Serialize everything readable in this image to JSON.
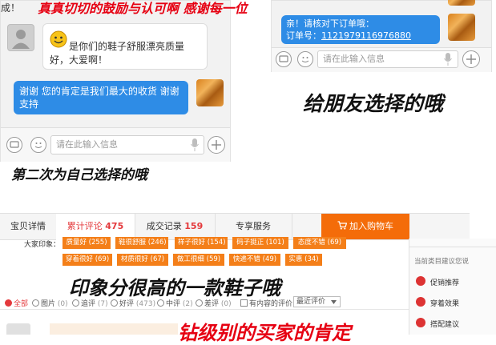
{
  "left_chat": {
    "top_text": "成！",
    "top_banner": "真真切切的鼓励与认可啊 感谢每一位",
    "customer_message": "是你们的鞋子舒服漂亮质量好，大爱啊！",
    "seller_reply": "谢谢 您的肯定是我们最大的收货 谢谢支持",
    "input_placeholder": "请在此输入信息"
  },
  "caption_left": "第二次为自己选择的哦",
  "right_chat": {
    "message_line1": "亲！请核对下订单哦：",
    "message_line2_label": "订单号：",
    "order_number": "1121979116976880",
    "input_placeholder": "请在此输入信息"
  },
  "caption_right": "给朋友选择的哦",
  "tabs": {
    "details": "宝贝详情",
    "reviews_label": "累计评论",
    "reviews_count": "475",
    "transactions_label": "成交记录",
    "transactions_count": "159",
    "service": "专享服务",
    "add_to_cart": "加入购物车"
  },
  "impression_label": "大家印象：",
  "impression_tags": [
    "质量好 (255)",
    "鞋很舒服 (246)",
    "样子很好 (154)",
    "码子挺正 (101)",
    "态度不错 (69)",
    "穿着很好 (69)",
    "材质很好 (67)",
    "做工很细 (59)",
    "快递不错 (49)",
    "实惠 (34)"
  ],
  "side_panel": {
    "title": "当前类目建议您说",
    "items": [
      "促销推荐",
      "穿着效果",
      "搭配建议"
    ]
  },
  "caption_middle": "印象分很高的一款鞋子哦",
  "filters": {
    "all": "全部",
    "image_label": "图片",
    "image_count": "(0)",
    "append_label": "追评",
    "append_count": "(7)",
    "good_label": "好评",
    "good_count": "(473)",
    "medium_label": "中评",
    "medium_count": "(2)",
    "bad_label": "差评",
    "bad_count": "(0)",
    "has_content": "有内容的评价",
    "sort_value": "最近评价"
  },
  "caption_bottom": "钻级别的买家的肯定",
  "colors": {
    "bubble_blue": "#2e8ce6",
    "tag_orange": "#f47f19",
    "cart_orange": "#f46c09",
    "accent_red": "#e4393c",
    "caption_red": "#e60012"
  }
}
